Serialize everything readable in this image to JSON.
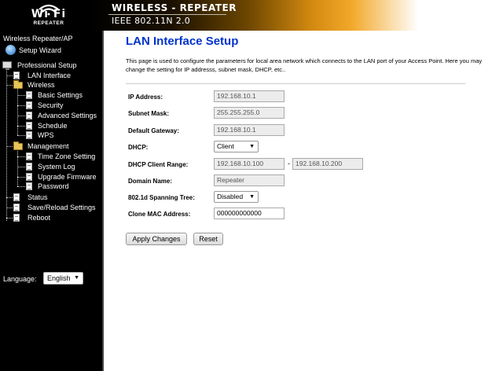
{
  "header": {
    "logo_text": "Wi Fi",
    "logo_subtitle": "REPEATER",
    "banner_title": "WIRELESS - REPEATER",
    "banner_subtitle": "IEEE 802.11N 2.0"
  },
  "sidebar": {
    "title": "Wireless Repeater/AP",
    "setup_wizard": "Setup Wizard",
    "professional_setup": "Professional Setup",
    "lan_interface": "LAN Interface",
    "wireless": "Wireless",
    "wireless_items": [
      "Basic Settings",
      "Security",
      "Advanced Settings",
      "Schedule",
      "WPS"
    ],
    "management": "Management",
    "management_items": [
      "Time Zone Setting",
      "System Log",
      "Upgrade Firmware",
      "Password"
    ],
    "status": "Status",
    "save_reload": "Save/Reload Settings",
    "reboot": "Reboot",
    "language_label": "Language:",
    "language_value": "English"
  },
  "main": {
    "title": "LAN Interface Setup",
    "description": "This page is used to configure the parameters for local area network which connects to the LAN port of your Access Point. Here you may change the setting for IP addresss, subnet mask, DHCP, etc..",
    "fields": {
      "ip_label": "IP Address:",
      "ip_value": "192.168.10.1",
      "mask_label": "Subnet Mask:",
      "mask_value": "255.255.255.0",
      "gateway_label": "Default Gateway:",
      "gateway_value": "192.168.10.1",
      "dhcp_label": "DHCP:",
      "dhcp_value": "Client",
      "range_label": "DHCP Client Range:",
      "range_start": "192.168.10.100",
      "range_dash": "-",
      "range_end": "192.168.10.200",
      "domain_label": "Domain Name:",
      "domain_value": "Repeater",
      "stp_label": "802.1d Spanning Tree:",
      "stp_value": "Disabled",
      "mac_label": "Clone MAC Address:",
      "mac_value": "000000000000"
    },
    "apply_label": "Apply Changes",
    "reset_label": "Reset"
  }
}
